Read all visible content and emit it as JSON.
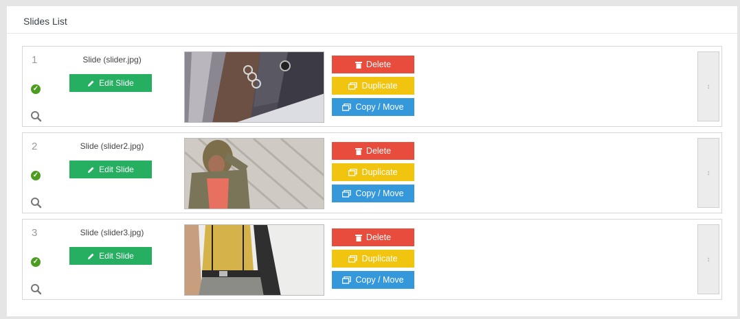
{
  "panel": {
    "title": "Slides List"
  },
  "slides": [
    {
      "number": "1",
      "name": "Slide (slider.jpg)",
      "edit_label": "Edit Slide",
      "delete_label": "Delete",
      "duplicate_label": "Duplicate",
      "copy_move_label": "Copy / Move"
    },
    {
      "number": "2",
      "name": "Slide (slider2.jpg)",
      "edit_label": "Edit Slide",
      "delete_label": "Delete",
      "duplicate_label": "Duplicate",
      "copy_move_label": "Copy / Move"
    },
    {
      "number": "3",
      "name": "Slide (slider3.jpg)",
      "edit_label": "Edit Slide",
      "delete_label": "Delete",
      "duplicate_label": "Duplicate",
      "copy_move_label": "Copy / Move"
    }
  ],
  "icons": {
    "status": "check-circle-icon",
    "preview": "search-icon",
    "edit": "pencil-icon",
    "delete": "trash-icon",
    "duplicate": "duplicate-icon",
    "copy_move": "copy-move-icon",
    "drag": "drag-handle-icon"
  },
  "colors": {
    "edit": "#26ae61",
    "delete": "#e74c3c",
    "duplicate": "#f1c40f",
    "copy_move": "#3498db",
    "status": "#4a9d1e"
  }
}
